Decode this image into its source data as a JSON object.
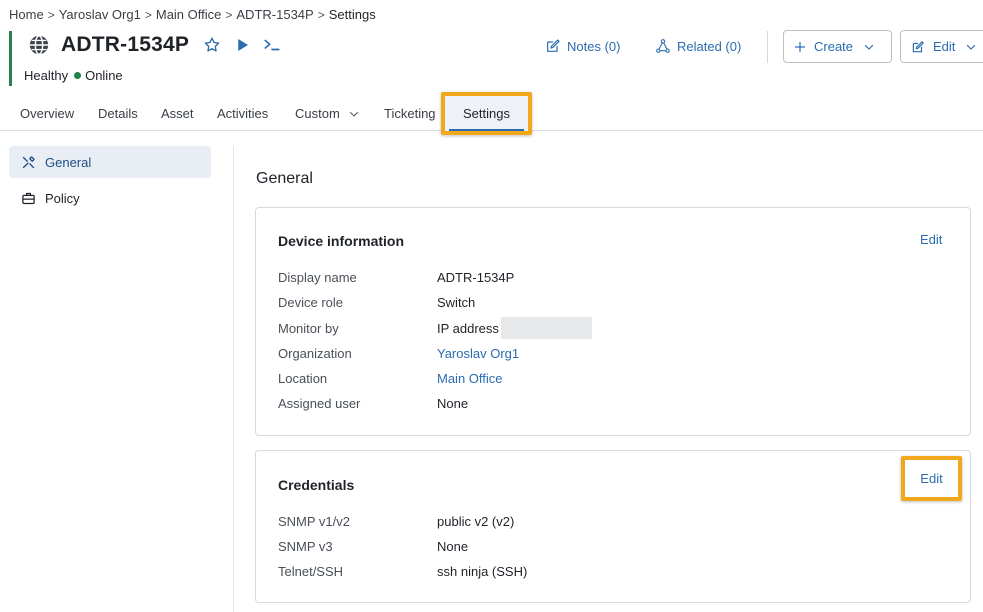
{
  "breadcrumb": {
    "items": [
      "Home",
      "Yaroslav Org1",
      "Main Office",
      "ADTR-1534P"
    ],
    "current": "Settings",
    "separator": ">"
  },
  "device": {
    "title": "ADTR-1534P",
    "health": "Healthy",
    "status": "Online",
    "status_color": "#1d8348",
    "icon": "globe-icon"
  },
  "header": {
    "notes_label": "Notes (0)",
    "related_label": "Related (0)",
    "create_label": "Create",
    "edit_label": "Edit"
  },
  "tabs": {
    "overview": "Overview",
    "details": "Details",
    "asset": "Asset",
    "activities": "Activities",
    "custom": "Custom",
    "ticketing": "Ticketing",
    "settings": "Settings",
    "active": "settings"
  },
  "sidebar": {
    "items": [
      {
        "label": "General",
        "icon": "tools-icon",
        "active": true
      },
      {
        "label": "Policy",
        "icon": "briefcase-icon",
        "active": false
      }
    ]
  },
  "main": {
    "section_title": "General",
    "device_info": {
      "title": "Device information",
      "edit_label": "Edit",
      "rows": [
        {
          "label": "Display name",
          "value": "ADTR-1534P"
        },
        {
          "label": "Device role",
          "value": "Switch"
        },
        {
          "label": "Monitor by",
          "value": "IP address"
        },
        {
          "label": "Organization",
          "value": "Yaroslav Org1"
        },
        {
          "label": "Location",
          "value": "Main Office"
        },
        {
          "label": "Assigned user",
          "value": "None"
        }
      ]
    },
    "credentials": {
      "title": "Credentials",
      "edit_label": "Edit",
      "rows": [
        {
          "label": "SNMP v1/v2",
          "value": "public v2 (v2)"
        },
        {
          "label": "SNMP v3",
          "value": "None"
        },
        {
          "label": "Telnet/SSH",
          "value": "ssh ninja (SSH)"
        }
      ]
    }
  },
  "colors": {
    "accent": "#2b6cb0",
    "highlight": "#f2a81d",
    "status_bar": "#2f7d4f"
  }
}
